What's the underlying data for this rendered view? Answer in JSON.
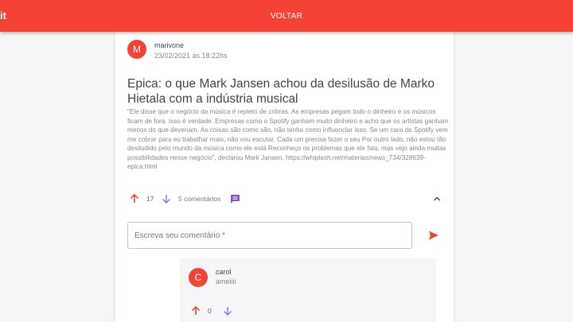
{
  "app": {
    "brand": "it",
    "back_label": "VOLTAR"
  },
  "post": {
    "avatar_initial": "M",
    "author": "marivone",
    "date": "23/02/2021 às 18:22hs",
    "title": "Epica: o que Mark Jansen achou da desilusão de Marko Hietala com a indústria musical",
    "body": "\"Ele disse que o negócio da música é repleto de cobras. As empresas pegam todo o dinheiro e os músicos ficam de fora. Isso é verdade. Empresas como o Spotify ganham muito dinheiro e acho que os artistas ganham menos do que deveriam. As coisas são como são, não tenho como influenciar isso. Se um cara do Spotify vem me cobrar para eu trabalhar mais, não vou escutar. Cada um precisa fazer o seu  Por outro lado, não estou tão desiludido pelo mundo da música como ele está Reconheço os problemas que ele fala, mas vejo ainda muitas possibilidades nesse negócio\", declarou Mark Jansen. https://whiplash.net/materias/news_734/328639-epica.html",
    "votes": "17",
    "comments_label": "5 comentários"
  },
  "comment_form": {
    "placeholder": "Escreva seu comentário *"
  },
  "comments": [
    {
      "avatar_initial": "C",
      "author": "carol",
      "text": "ameiiii",
      "votes": "0"
    }
  ],
  "colors": {
    "primary": "#f44336",
    "accent_purple": "#7e57c2",
    "down_arrow": "#7986cb"
  }
}
